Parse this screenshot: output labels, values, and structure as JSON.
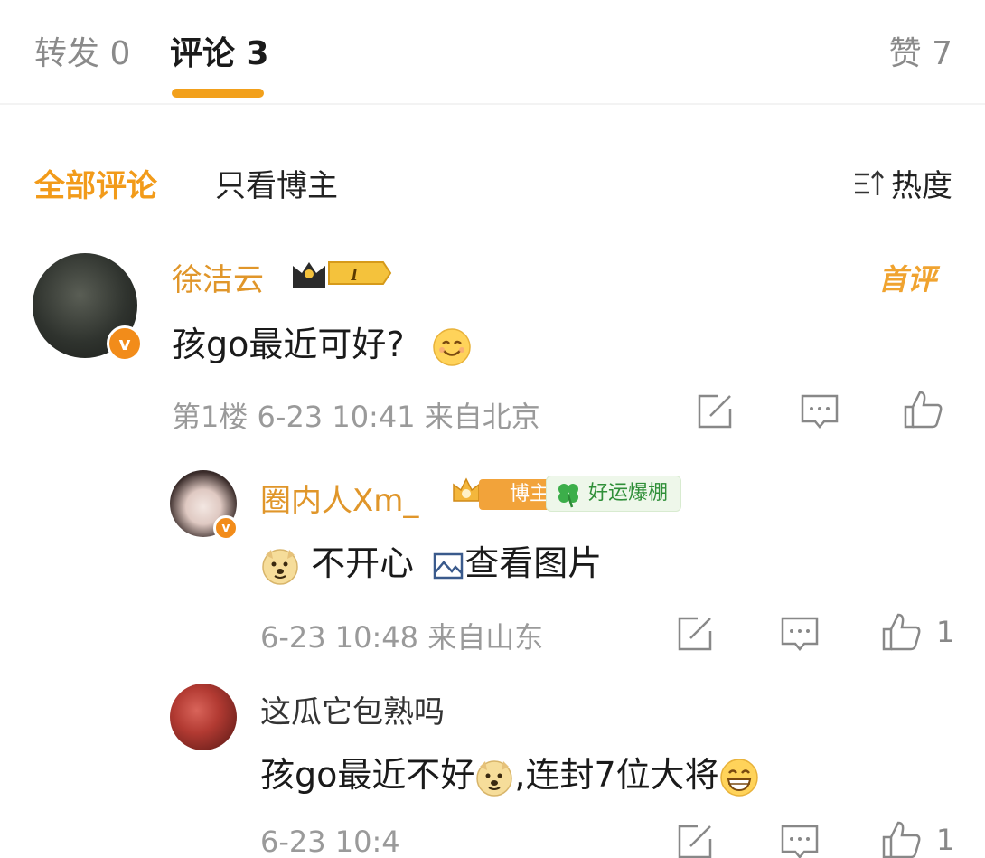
{
  "tabs": {
    "repost": "转发 0",
    "comment": "评论 3",
    "like": "赞 7"
  },
  "filter": {
    "all": "全部评论",
    "owner_only": "只看博主",
    "sort": "热度"
  },
  "colors": {
    "accent": "#f2a01b",
    "username": "#e0962a",
    "meta": "#9a9a9a"
  },
  "comments": [
    {
      "user": "徐洁云",
      "level_badge": "I",
      "first_badge": "首评",
      "text": "孩go最近可好?",
      "meta": "第1楼 6-23 10:41 来自北京",
      "emoji": "smile-emoji"
    },
    {
      "user": "圈内人Xm_",
      "owner_tag": "博主",
      "lucky_tag": "好运爆棚",
      "text_before": "不开心",
      "image_link": "查看图片",
      "meta": "6-23 10:48 来自山东",
      "like_count": "1",
      "emoji": "doge-emoji"
    },
    {
      "user": "这瓜它包熟吗",
      "text_part1": "孩go最近不好",
      "text_part2": ",连封7位大将",
      "meta": "6-23 10:4",
      "like_count": "1",
      "emoji": "grin-emoji"
    }
  ]
}
